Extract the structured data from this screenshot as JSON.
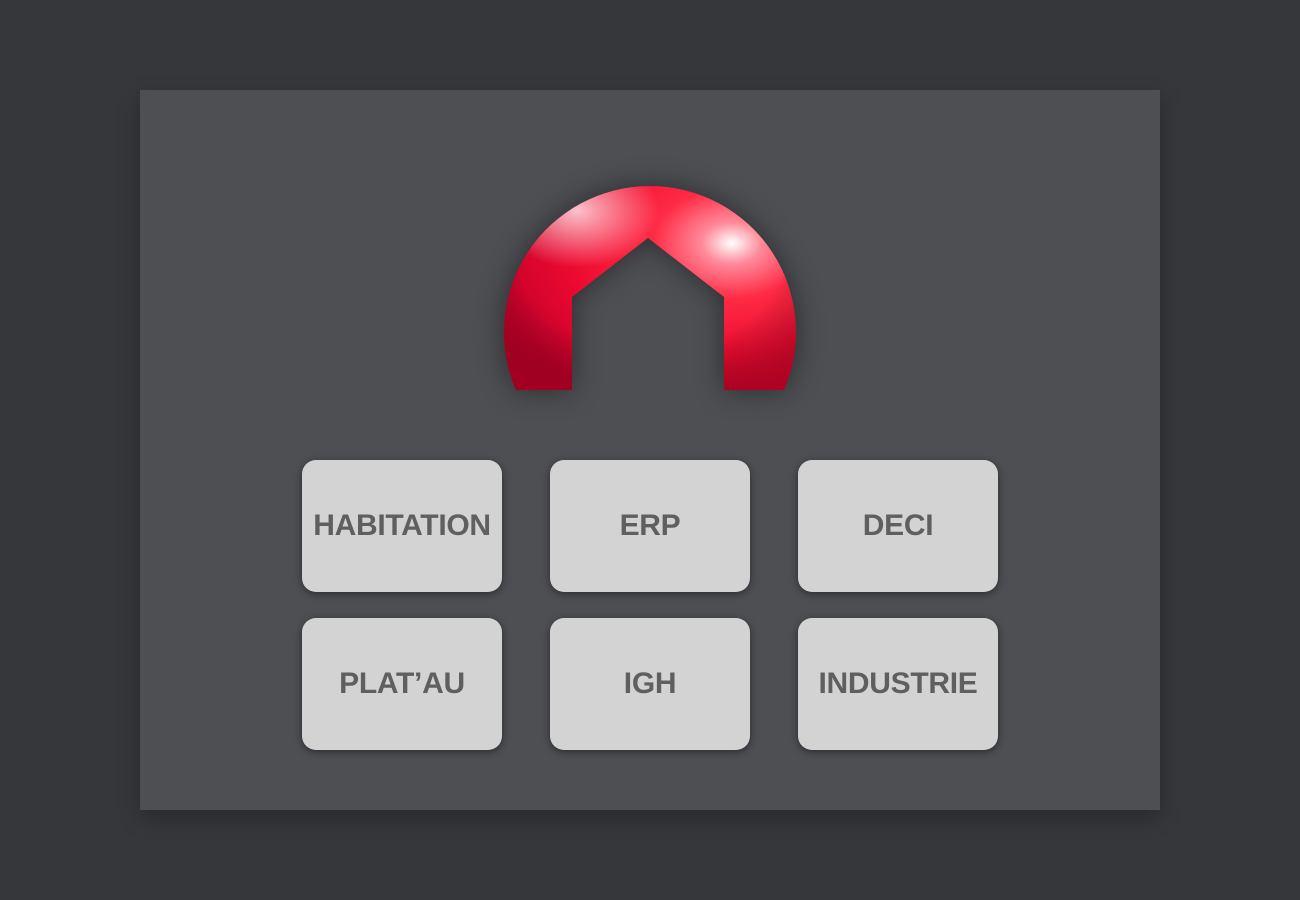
{
  "logo": {
    "icon": "house-arch-icon",
    "colors": {
      "primary": "#ff1a3a",
      "dark": "#c40020",
      "highlight": "#ffffff"
    }
  },
  "tiles": [
    {
      "label": "HABITATION"
    },
    {
      "label": "ERP"
    },
    {
      "label": "DECI"
    },
    {
      "label": "PLAT’AU"
    },
    {
      "label": "IGH"
    },
    {
      "label": "INDUSTRIE"
    }
  ],
  "colors": {
    "background": "#36373b",
    "panel": "#4e4f53",
    "tile": "#d3d3d3",
    "tile_text": "#5f5f60"
  }
}
